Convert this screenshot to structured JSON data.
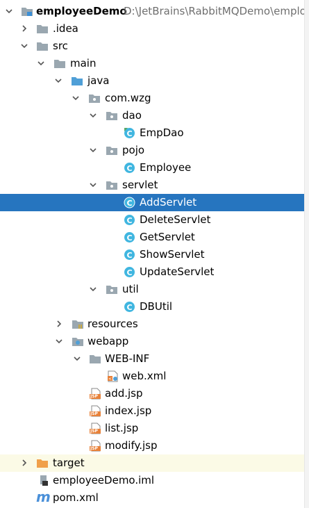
{
  "tree": {
    "root": {
      "name": "employeeDemo",
      "path": "D:\\JetBrains\\RabbitMQDemo\\emplo",
      "icon": "module-folder-icon",
      "expanded": true
    },
    "idea": {
      "name": ".idea",
      "icon": "folder-icon",
      "expanded": false
    },
    "src": {
      "name": "src",
      "icon": "folder-icon",
      "expanded": true
    },
    "main": {
      "name": "main",
      "icon": "folder-icon",
      "expanded": true
    },
    "java": {
      "name": "java",
      "icon": "source-root-folder-icon",
      "expanded": true
    },
    "com_wzg": {
      "name": "com.wzg",
      "icon": "package-icon",
      "expanded": true
    },
    "dao": {
      "name": "dao",
      "icon": "package-icon",
      "expanded": true
    },
    "EmpDao": {
      "name": "EmpDao",
      "icon": "interface-icon"
    },
    "pojo": {
      "name": "pojo",
      "icon": "package-icon",
      "expanded": true
    },
    "Employee": {
      "name": "Employee",
      "icon": "class-icon"
    },
    "servlet": {
      "name": "servlet",
      "icon": "package-icon",
      "expanded": true
    },
    "AddServlet": {
      "name": "AddServlet",
      "icon": "class-icon",
      "selected": true
    },
    "DeleteServlet": {
      "name": "DeleteServlet",
      "icon": "class-icon"
    },
    "GetServlet": {
      "name": "GetServlet",
      "icon": "class-icon"
    },
    "ShowServlet": {
      "name": "ShowServlet",
      "icon": "class-icon"
    },
    "UpdateServlet": {
      "name": "UpdateServlet",
      "icon": "class-icon"
    },
    "util": {
      "name": "util",
      "icon": "package-icon",
      "expanded": true
    },
    "DBUtil": {
      "name": "DBUtil",
      "icon": "class-icon"
    },
    "resources": {
      "name": "resources",
      "icon": "resources-folder-icon",
      "expanded": false
    },
    "webapp": {
      "name": "webapp",
      "icon": "web-folder-icon",
      "expanded": true
    },
    "WEB_INF": {
      "name": "WEB-INF",
      "icon": "folder-icon",
      "expanded": true
    },
    "web_xml": {
      "name": "web.xml",
      "icon": "web-xml-icon"
    },
    "add_jsp": {
      "name": "add.jsp",
      "icon": "jsp-file-icon",
      "badge": "JSP"
    },
    "index_jsp": {
      "name": "index.jsp",
      "icon": "jsp-file-icon",
      "badge": "JSP"
    },
    "list_jsp": {
      "name": "list.jsp",
      "icon": "jsp-file-icon",
      "badge": "JSP"
    },
    "modify_jsp": {
      "name": "modify.jsp",
      "icon": "jsp-file-icon",
      "badge": "JSP"
    },
    "target": {
      "name": "target",
      "icon": "excluded-folder-icon",
      "expanded": false
    },
    "iml": {
      "name": "employeeDemo.iml",
      "icon": "iml-file-icon"
    },
    "pom": {
      "name": "pom.xml",
      "icon": "maven-m-icon",
      "glyph": "m"
    }
  },
  "colors": {
    "selection": "#2675bf",
    "excluded_row": "#fbfae6",
    "folder": "#9aa7b0",
    "source_root": "#4f9fd7",
    "excluded_folder": "#f0a04b",
    "class_badge": "#40b6e0",
    "jsp": "#e8823a",
    "maven": "#4a90d9"
  }
}
